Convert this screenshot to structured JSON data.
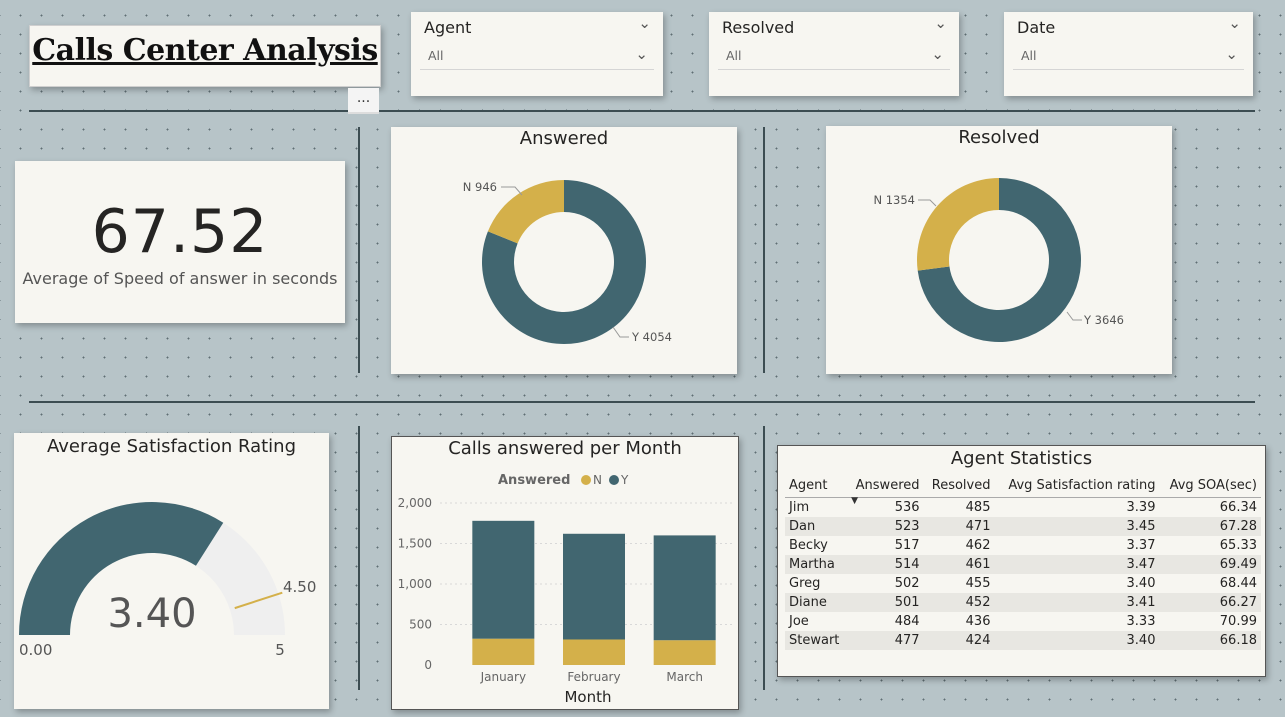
{
  "title": "Calls Center Analysis",
  "more_options": "...",
  "slicers": [
    {
      "label": "Agent",
      "value": "All"
    },
    {
      "label": "Resolved",
      "value": "All"
    },
    {
      "label": "Date",
      "value": "All"
    }
  ],
  "icons": {
    "chevron": "chevron-down-icon"
  },
  "kpi": {
    "value": "67.52",
    "label": "Average of Speed of answer in seconds"
  },
  "colors": {
    "Y": "#416670",
    "N": "#d4b04a",
    "gauge_bg": "#efefef",
    "card": "#f7f6f1"
  },
  "answered_donut": {
    "title": "Answered",
    "slices": [
      {
        "name": "N",
        "value": 946,
        "label": "N 946"
      },
      {
        "name": "Y",
        "value": 4054,
        "label": "Y 4054"
      }
    ]
  },
  "resolved_donut": {
    "title": "Resolved",
    "slices": [
      {
        "name": "N",
        "value": 1354,
        "label": "N 1354"
      },
      {
        "name": "Y",
        "value": 3646,
        "label": "Y 3646"
      }
    ]
  },
  "gauge": {
    "title": "Average Satisfaction Rating",
    "value": 3.4,
    "value_label": "3.40",
    "min": 0,
    "min_label": "0.00",
    "max": 5,
    "max_label": "5",
    "target": 4.5,
    "target_label": "4.50"
  },
  "chart_data": {
    "type": "bar",
    "stacked": true,
    "title": "Calls answered per Month",
    "legend_title": "Answered",
    "legend_position": "top",
    "categories": [
      "January",
      "February",
      "March"
    ],
    "series": [
      {
        "name": "N",
        "values": [
          325,
          315,
          306
        ]
      },
      {
        "name": "Y",
        "values": [
          1455,
          1305,
          1294
        ]
      }
    ],
    "xlabel": "Month",
    "ylabel": "",
    "ylim": [
      0,
      2000
    ],
    "yticks": [
      0,
      500,
      1000,
      1500,
      2000
    ],
    "ytick_labels": [
      "0",
      "500",
      "1,000",
      "1,500",
      "2,000"
    ],
    "grid": true
  },
  "agent_table": {
    "title": "Agent Statistics",
    "columns": [
      "Agent",
      "Answered",
      "Resolved",
      "Avg Satisfaction rating",
      "Avg SOA(sec)"
    ],
    "rows": [
      [
        "Jim",
        "536",
        "485",
        "3.39",
        "66.34"
      ],
      [
        "Dan",
        "523",
        "471",
        "3.45",
        "67.28"
      ],
      [
        "Becky",
        "517",
        "462",
        "3.37",
        "65.33"
      ],
      [
        "Martha",
        "514",
        "461",
        "3.47",
        "69.49"
      ],
      [
        "Greg",
        "502",
        "455",
        "3.40",
        "68.44"
      ],
      [
        "Diane",
        "501",
        "452",
        "3.41",
        "66.27"
      ],
      [
        "Joe",
        "484",
        "436",
        "3.33",
        "70.99"
      ],
      [
        "Stewart",
        "477",
        "424",
        "3.40",
        "66.18"
      ]
    ]
  }
}
